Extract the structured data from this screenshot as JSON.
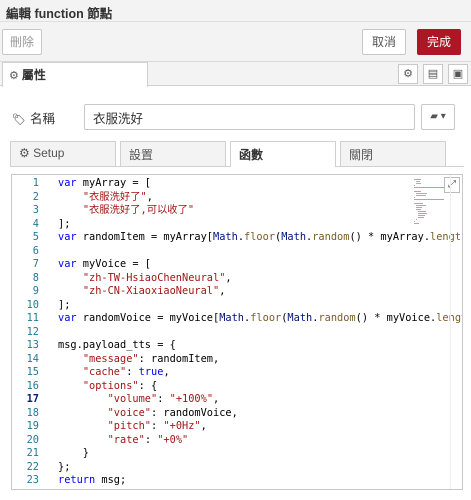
{
  "title": "編輯 function 節點",
  "toolbar": {
    "delete_label": "刪除",
    "cancel_label": "取消",
    "done_label": "完成",
    "accent": "#ad1625"
  },
  "tabs": {
    "properties_label": "屬性"
  },
  "name_field": {
    "label": "名稱",
    "value": "衣服洗好"
  },
  "subtabs": [
    {
      "label": "Setup",
      "icon": "gear-icon"
    },
    {
      "label": "設置"
    },
    {
      "label": "函數",
      "active": true
    },
    {
      "label": "關閉"
    }
  ],
  "editor": {
    "current_line": 17,
    "lines": [
      "var myArray = [",
      "    \"衣服洗好了\",",
      "    \"衣服洗好了,可以收了\"",
      "];",
      "var randomItem = myArray[Math.floor(Math.random() * myArray.length",
      "",
      "var myVoice = [",
      "    \"zh-TW-HsiaoChenNeural\",",
      "    \"zh-CN-XiaoxiaoNeural\",",
      "];",
      "var randomVoice = myVoice[Math.floor(Math.random() * myVoice.lengt",
      "",
      "msg.payload_tts = {",
      "    \"message\": randomItem,",
      "    \"cache\": true,",
      "    \"options\": {",
      "        \"volume\": \"+100%\",",
      "        \"voice\": randomVoice,",
      "        \"pitch\": \"+0Hz\",",
      "        \"rate\": \"+0%\"",
      "    }",
      "};",
      "return msg;"
    ]
  }
}
